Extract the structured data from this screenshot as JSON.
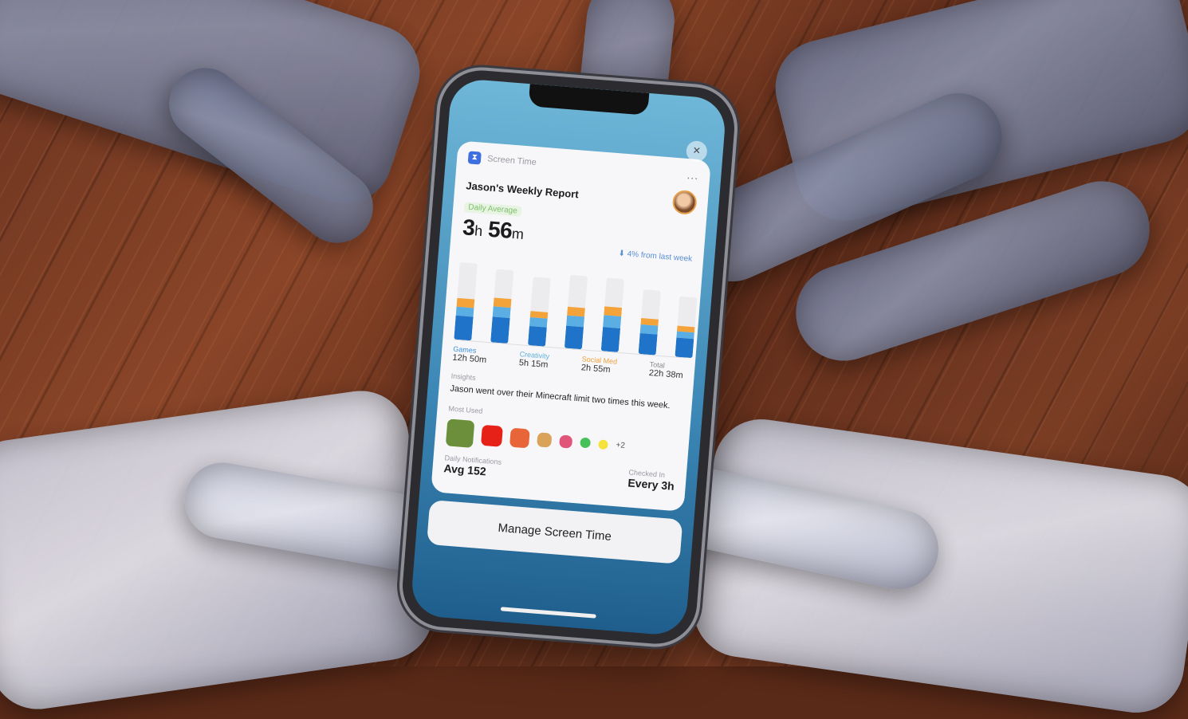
{
  "notification": {
    "app_name": "Screen Time",
    "title": "Jason's Weekly Report",
    "more_glyph": "...",
    "close_glyph": "×"
  },
  "daily": {
    "label": "Daily Average",
    "hours": "3",
    "h_unit": "h",
    "minutes": "56",
    "m_unit": "m",
    "trend": "4% from last week"
  },
  "chart_data": {
    "type": "bar",
    "stacked": true,
    "series": [
      {
        "values": [
          0.28,
          0.3,
          0.22,
          0.26,
          0.28,
          0.24,
          0.22
        ]
      },
      {
        "values": [
          0.1,
          0.12,
          0.1,
          0.12,
          0.14,
          0.1,
          0.08
        ]
      },
      {
        "values": [
          0.1,
          0.1,
          0.08,
          0.1,
          0.1,
          0.08,
          0.06
        ]
      }
    ],
    "colors": [
      "#1f73c8",
      "#5aaee3",
      "#f4a23a"
    ],
    "background_totals": [
      0.9,
      0.85,
      0.8,
      0.85,
      0.85,
      0.75,
      0.7
    ]
  },
  "categories": [
    {
      "name": "Games",
      "value": "12h 50m",
      "cls": "c-games"
    },
    {
      "name": "Creativity",
      "value": "5h 15m",
      "cls": "c-creat"
    },
    {
      "name": "Social Med",
      "value": "2h 55m",
      "cls": "c-social"
    },
    {
      "name": "Total",
      "value": "22h 38m",
      "cls": "c-total"
    }
  ],
  "insights": {
    "label": "Insights",
    "text": "Jason went over their Minecraft limit two times this week."
  },
  "most_used": {
    "label": "Most Used",
    "apps": [
      "minecraft-app-icon",
      "youtube-app-icon",
      "game-app-icon",
      "character-app-icon",
      "instagram-app-icon",
      "messages-app-icon",
      "snapchat-app-icon"
    ],
    "app_colors": [
      "#6b8f3a",
      "#e62117",
      "#e8653a",
      "#d9a35a",
      "#e2557a",
      "#46c15a",
      "#f5e23a"
    ],
    "overflow": "+2"
  },
  "stats": {
    "pickups_label": "Daily Notifications",
    "pickups_value": "Avg 152",
    "check_label": "Checked In",
    "check_value": "Every 3h"
  },
  "manage_button": "Manage Screen Time"
}
